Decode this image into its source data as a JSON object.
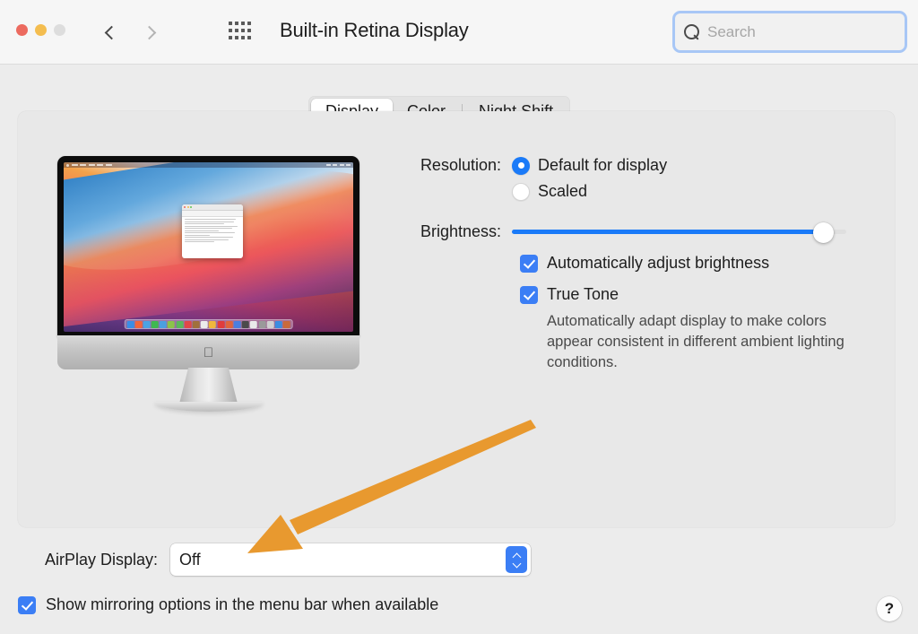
{
  "window": {
    "title": "Built-in Retina Display",
    "traffic_lights": [
      "close",
      "minimize",
      "zoom"
    ],
    "back_label": "Back",
    "forward_label": "Forward",
    "grid_label": "Show All"
  },
  "search": {
    "placeholder": "Search",
    "value": "",
    "icon": "search-icon"
  },
  "tabs": [
    {
      "label": "Display",
      "active": true
    },
    {
      "label": "Color",
      "active": false
    },
    {
      "label": "Night Shift",
      "active": false
    }
  ],
  "resolution": {
    "label": "Resolution:",
    "options": [
      {
        "label": "Default for display",
        "selected": true
      },
      {
        "label": "Scaled",
        "selected": false
      }
    ]
  },
  "brightness": {
    "label": "Brightness:",
    "value_percent": 96
  },
  "checkboxes": [
    {
      "label": "Automatically adjust brightness",
      "checked": true
    },
    {
      "label": "True Tone",
      "checked": true
    }
  ],
  "true_tone_description": "Automatically adapt display to make colors appear consistent in different ambient lighting conditions.",
  "airplay": {
    "label": "AirPlay Display:",
    "value": "Off",
    "options": [
      "Off"
    ]
  },
  "mirroring": {
    "label": "Show mirroring options in the menu bar when available",
    "checked": true
  },
  "help": {
    "label": "?"
  },
  "colors": {
    "accent_blue": "#1a7af8",
    "checkbox_blue": "#3b7ef5",
    "window_bg": "#ececec",
    "panel_bg": "#e8e8e8",
    "toolbar_bg": "#f6f6f6",
    "annotation_orange": "#e8992f",
    "traffic_red": "#ec6a5f",
    "traffic_yellow": "#f4bd4f",
    "traffic_grey": "#dddddd"
  },
  "preview": {
    "device": "iMac",
    "wallpaper": "macOS Big Sur",
    "apple_logo": "",
    "dock_icon_colors": [
      "#3a8ee6",
      "#f2663c",
      "#4ba3e3",
      "#3fb950",
      "#4b9fe0",
      "#8bc34a",
      "#5bb85b",
      "#e04848",
      "#a0703c",
      "#ececec",
      "#efb83c",
      "#e03c3c",
      "#e0653c",
      "#4b7fe0",
      "#4b4b4b",
      "#eaeaea",
      "#9a9a9a",
      "#d0d0d0",
      "#3c8ce0",
      "#c86a3c"
    ],
    "dock_icon_count": 20,
    "textedit_line_count": 11
  }
}
